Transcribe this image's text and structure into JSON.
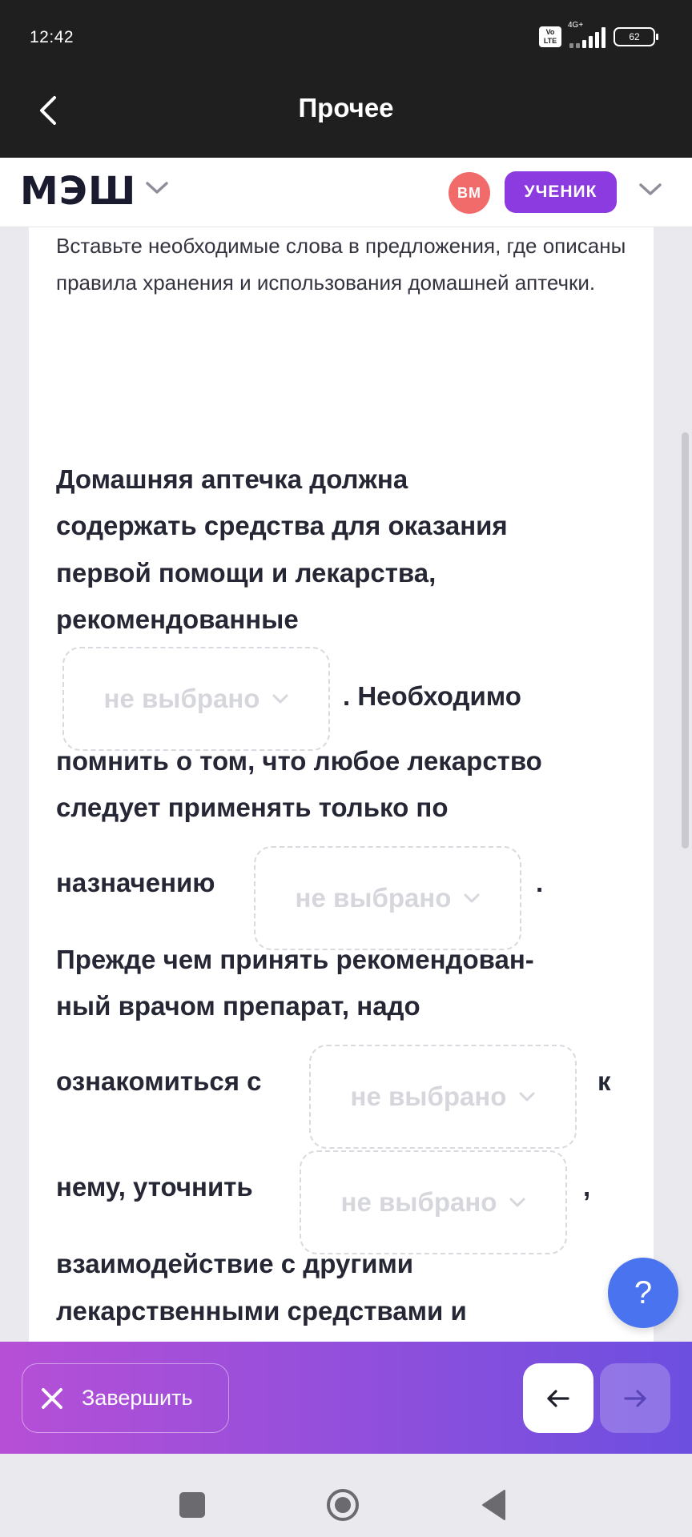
{
  "status_bar": {
    "time": "12:42",
    "volte": "Vo\nLTE",
    "network": "4G+",
    "battery": "62"
  },
  "title_bar": {
    "title": "Прочее",
    "back_icon": "chevron-left-icon"
  },
  "header": {
    "logo": "МЭШ",
    "avatar_initials": "ВМ",
    "role_label": "УЧЕНИК",
    "colors": {
      "avatar": "#f26b6b",
      "role_badge": "#8c3be0"
    }
  },
  "task": {
    "instruction": "Вставьте необходимые слова в предложения, где описаны правила хранения и использования домашней аптечки.",
    "lines": [
      "Домашняя аптечка должна",
      "содержать средства для оказания",
      "первой помощи и лекарства,",
      "рекомендованные",
      ". Необходимо",
      "помнить о том, что любое лекарство",
      "следует применять только по",
      "назначению",
      ".",
      "Прежде чем принять рекомендован-",
      "ный врачом препарат, надо",
      "ознакомиться с",
      "к",
      "нему, уточнить",
      ",",
      "взаимодействие с другими",
      "лекарственными средствами и"
    ],
    "selects": [
      {
        "value": "не выбрано"
      },
      {
        "value": "не выбрано"
      },
      {
        "value": "не выбрано"
      },
      {
        "value": "не выбрано"
      }
    ]
  },
  "help_button": {
    "label": "?"
  },
  "bottom_bar": {
    "finish_label": "Завершить",
    "prev_icon": "arrow-left-icon",
    "next_icon": "arrow-right-icon",
    "gradient": [
      "#b64fd6",
      "#6c4fe0"
    ]
  },
  "system_nav": {
    "icons": [
      "recents-square-icon",
      "home-circle-icon",
      "back-triangle-icon"
    ]
  }
}
